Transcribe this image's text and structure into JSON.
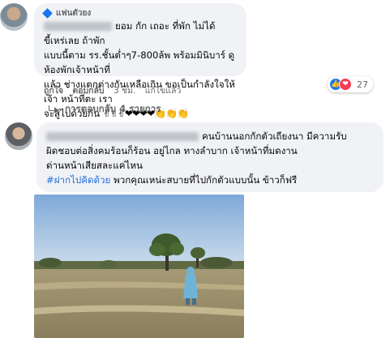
{
  "comment1": {
    "badge": "แฟนตัวยง",
    "text_line1": "ยอม กัก เถอะ ที่พัก ไม่ได้ ขี้เหร่เลย ถ้าพัก",
    "text_line2": "แบบนี้ตาม รร.ชั้นต่ำๆ7-800ล้พ พร้อมมินิบาร์ ดูห้องพักเจ้าหน้าที่",
    "text_line3": "แล้ว ช่างแตกต่างกันเหลือเกิน ขอเป็นกำลังใจให้เจ้า หน้าที่ตะ เรา",
    "text_line4": "จะสู้ไปด้วยกัน",
    "emojis": "✌✌✌❤❤❤❤👏👏👏",
    "actions": {
      "like": "ถูกใจ",
      "reply": "ตอบกลับ",
      "time": "3 ชม.",
      "edited": "แก้ไขแล้ว",
      "sep": "·"
    },
    "reactions": {
      "count": "27",
      "like_icon": "like-icon",
      "love_icon": "love-icon"
    }
  },
  "replies_link": {
    "label": "การตอบกลับ 4 รายการ",
    "icon": "reply-arrow-icon"
  },
  "comment2": {
    "text_line1": "คนบ้านนอกกักตัวเถียงนา มีความรับ",
    "text_line2": "ผิดชอบต่อสิ่งคมร้อนก็ร้อน อยู่ไกล ทางลำบาก เจ้าหน้าที่มดงาน",
    "text_line3": "ด่านหน้าเสียสละแค่ไหน",
    "hashtag": "#ฝากไปคิดด้วย",
    "text_line4": "พวกคุณเหน่ะสบายที่ไปกักตัวแบบนั้น ข้าวก็ฟรี"
  },
  "colors": {
    "bubble": "#f0f2f5",
    "link": "#216fdb",
    "meta": "#65676b",
    "like": "#1877f2",
    "love": "#f33e58"
  }
}
